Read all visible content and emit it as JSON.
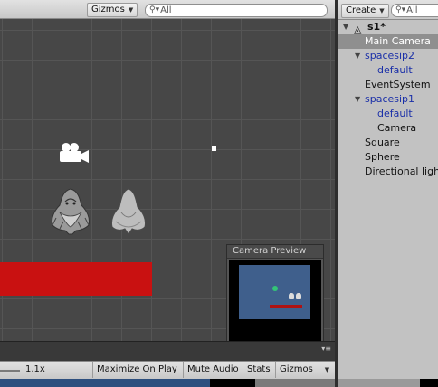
{
  "scene_toolbar": {
    "gizmos_label": "Gizmos",
    "search_placeholder": "All"
  },
  "camera_preview": {
    "title": "Camera Preview"
  },
  "game_toolbar": {
    "scale_label": "1.1x",
    "maximize_label": "Maximize On Play",
    "mute_label": "Mute Audio",
    "stats_label": "Stats",
    "gizmos_label": "Gizmos"
  },
  "hierarchy": {
    "create_label": "Create",
    "search_placeholder": "All",
    "scene_name": "s1*",
    "items": [
      {
        "label": "Main Camera",
        "selected": true
      },
      {
        "label": "spacesip2",
        "prefab": true,
        "expanded": true
      },
      {
        "label": "default",
        "prefab": true
      },
      {
        "label": "EventSystem"
      },
      {
        "label": "spacesip1",
        "prefab": true,
        "expanded": true
      },
      {
        "label": "default",
        "prefab": true
      },
      {
        "label": "Camera"
      },
      {
        "label": "Square"
      },
      {
        "label": "Sphere"
      },
      {
        "label": "Directional light"
      }
    ]
  },
  "colors": {
    "selection": "#8f8f8f",
    "prefab_text": "#1a2fa8",
    "red_bar": "#c91111",
    "preview_background": "#3f5f8c"
  }
}
